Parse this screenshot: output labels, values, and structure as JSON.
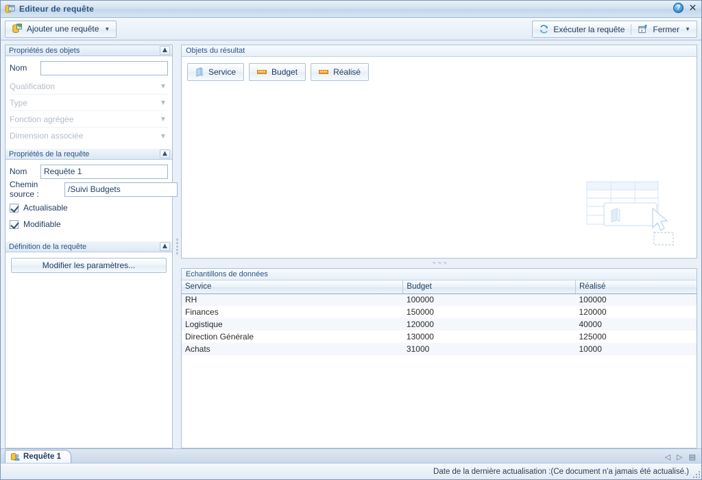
{
  "window": {
    "title": "Editeur de requête",
    "app_icon": "database-window-icon",
    "help_label": "?",
    "close_label": "✕"
  },
  "toolbar": {
    "add_query_label": "Ajouter une requête",
    "add_query_icon": "add-database-icon",
    "run_query_label": "Exécuter la requête",
    "run_query_icon": "refresh-icon",
    "close_label": "Fermer",
    "close_icon": "close-window-icon",
    "caret": "▼"
  },
  "left_panel": {
    "object_properties": {
      "title": "Propriétés des objets",
      "collapse_icon": "chevron-double-up-icon",
      "name_label": "Nom",
      "name_value": "",
      "name_placeholder": "",
      "disabled_fields": [
        {
          "label": "Qualification",
          "arrow": "▼"
        },
        {
          "label": "Type",
          "arrow": "▼"
        },
        {
          "label": "Fonction agrégée",
          "arrow": "▼"
        },
        {
          "label": "Dimension associée",
          "arrow": "▼"
        }
      ]
    },
    "query_properties": {
      "title": "Propriétés de la requête",
      "collapse_icon": "chevron-double-up-icon",
      "name_label": "Nom",
      "name_value": "Requête 1",
      "source_label": "Chemin source :",
      "source_value": "/Suivi Budgets",
      "checkboxes": [
        {
          "label": "Actualisable",
          "checked": true
        },
        {
          "label": "Modifiable",
          "checked": true
        }
      ]
    },
    "query_definition": {
      "title": "Définition de la requête",
      "collapse_icon": "chevron-double-up-icon",
      "edit_params_label": "Modifier les paramètres..."
    }
  },
  "result_objects": {
    "title": "Objets du résultat",
    "chips": [
      {
        "label": "Service",
        "icon": "dimension-icon",
        "kind": "dimension"
      },
      {
        "label": "Budget",
        "icon": "measure-icon",
        "kind": "measure"
      },
      {
        "label": "Réalisé",
        "icon": "measure-icon",
        "kind": "measure"
      }
    ],
    "drop_hint_icon": "drag-drop-table-hint"
  },
  "data_samples": {
    "title": "Echantillons de données",
    "watermark": "Echantillons de données",
    "columns": [
      "Service",
      "Budget",
      "Réalisé"
    ],
    "rows": [
      [
        "RH",
        "100000",
        "100000"
      ],
      [
        "Finances",
        "150000",
        "120000"
      ],
      [
        "Logistique",
        "120000",
        "40000"
      ],
      [
        "Direction Générale",
        "130000",
        "125000"
      ],
      [
        "Achats",
        "31000",
        "10000"
      ]
    ]
  },
  "tabs": [
    {
      "label": "Requête 1",
      "icon": "query-tab-icon",
      "active": true
    }
  ],
  "nav": {
    "prev_icon": "◁",
    "next_icon": "▷",
    "list_icon": "▤"
  },
  "status": {
    "text": "Date de la dernière actualisation :(Ce document n'a jamais été actualisé.)"
  },
  "colors": {
    "accent": "#2d5382",
    "border": "#a9bfd8",
    "measure_orange": "#f0a030",
    "dimension_blue": "#9cc3e8",
    "watermark": "#e3e3e3"
  }
}
